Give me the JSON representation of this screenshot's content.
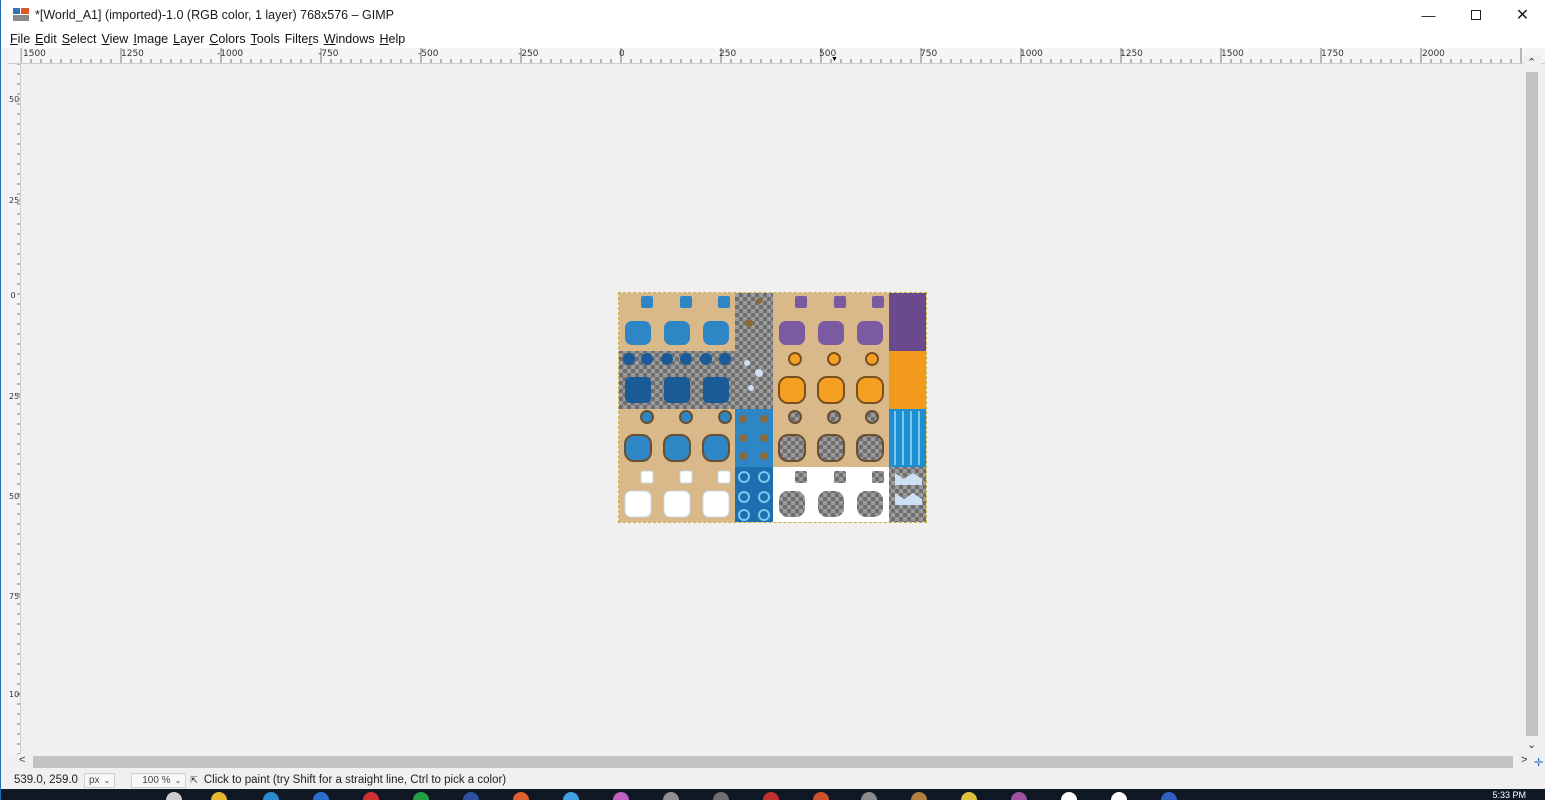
{
  "window": {
    "title": "*[World_A1] (imported)-1.0 (RGB color, 1 layer) 768x576 – GIMP",
    "minimize_icon": "minimize-icon",
    "maximize_icon": "maximize-icon",
    "close_icon": "close-icon"
  },
  "menu": [
    {
      "label": "File",
      "u": "F",
      "rest": "ile"
    },
    {
      "label": "Edit",
      "u": "E",
      "rest": "dit"
    },
    {
      "label": "Select",
      "u": "S",
      "rest": "elect"
    },
    {
      "label": "View",
      "u": "V",
      "rest": "iew"
    },
    {
      "label": "Image",
      "u": "I",
      "rest": "mage"
    },
    {
      "label": "Layer",
      "u": "L",
      "rest": "ayer"
    },
    {
      "label": "Colors",
      "u": "C",
      "rest": "olors"
    },
    {
      "label": "Tools",
      "u": "T",
      "rest": "ools"
    },
    {
      "label": "Filters",
      "u": "F",
      "rest": "ilters",
      "pre": "Filte",
      "mid": "r",
      "post": "s"
    },
    {
      "label": "Windows",
      "u": "W",
      "rest": "indows"
    },
    {
      "label": "Help",
      "u": "H",
      "rest": "elp"
    }
  ],
  "hruler": {
    "labels": [
      "1500",
      "1250",
      "-1000",
      "-750",
      "-500",
      "-250",
      "0",
      "250",
      "500",
      "750",
      "1000",
      "1250",
      "1500",
      "1750",
      "2000"
    ]
  },
  "vruler": {
    "labels": [
      "500",
      "250",
      "0",
      "250",
      "500",
      "750",
      "1000"
    ]
  },
  "status": {
    "coords": "539.0, 259.0",
    "unit": "px",
    "zoom": "100 %",
    "message": "Click to paint (try Shift for a straight line, Ctrl to pick a color)"
  },
  "taskbar": {
    "clock": "5:33 PM"
  },
  "colors": {
    "sand": "#d9b98a",
    "water_light": "#2f86c4",
    "water_dark": "#1a5a96",
    "purple": "#6a4a8c",
    "lava": "#f29a1c",
    "checker": "#9a9a9a",
    "snow": "#ffffff"
  }
}
